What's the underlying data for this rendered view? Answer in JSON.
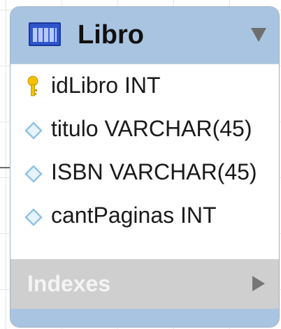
{
  "table": {
    "name": "Libro",
    "columns": [
      {
        "label": "idLibro INT",
        "icon": "primary-key-icon"
      },
      {
        "label": "titulo VARCHAR(45)",
        "icon": "column-diamond-icon"
      },
      {
        "label": "ISBN VARCHAR(45)",
        "icon": "column-diamond-icon"
      },
      {
        "label": "cantPaginas INT",
        "icon": "column-diamond-icon"
      }
    ],
    "indexes_label": "Indexes"
  },
  "colors": {
    "header": "#a9c4e0",
    "indexes_bar": "#cfcfcf",
    "key": "#f2c200",
    "diamond": "#8fc3e8"
  }
}
